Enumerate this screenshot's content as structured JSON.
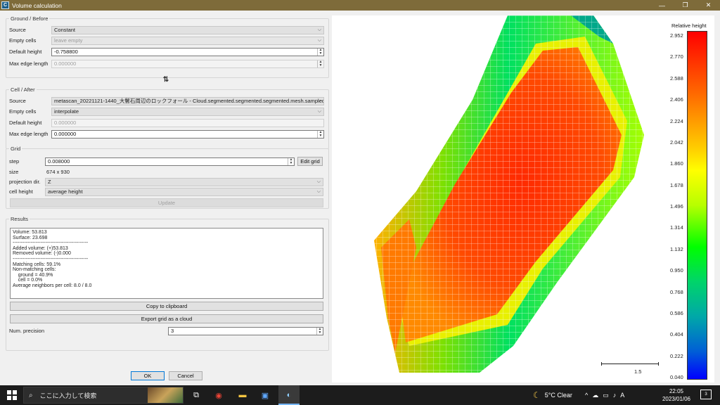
{
  "window": {
    "title": "Volume calculation",
    "icon_text": "C",
    "minimize": "—",
    "maximize": "❐",
    "close": "✕"
  },
  "ground": {
    "group_title": "Ground / Before",
    "source_label": "Source",
    "source_value": "Constant",
    "empty_label": "Empty cells",
    "empty_value": "leave empty",
    "default_height_label": "Default height",
    "default_height_value": "-0.758800",
    "max_edge_label": "Max edge length",
    "max_edge_value": "0.000000"
  },
  "swap_icon": "⇅",
  "cell": {
    "group_title": "Cell / After",
    "source_label": "Source",
    "source_value": "metascan_20221121-1440_大鬢石周辺のロックフォール - Cloud.segmented.segmented.segmented.mesh.sampled",
    "empty_label": "Empty cells",
    "empty_value": "interpolate",
    "default_height_label": "Default height",
    "default_height_value": "0.000000",
    "max_edge_label": "Max edge length",
    "max_edge_value": "0.000000"
  },
  "grid": {
    "group_title": "Grid",
    "step_label": "step",
    "step_value": "0.008000",
    "edit_grid": "Edit grid",
    "size_label": "size",
    "size_value": "674 x 930",
    "projection_label": "projection dir.",
    "projection_value": "Z",
    "cell_height_label": "cell height",
    "cell_height_value": "average height",
    "update": "Update"
  },
  "results": {
    "group_title": "Results",
    "text": "Volume: 53.813\nSurface: 23.698\n----------------------------------------------\nAdded volume: (+)53.813\nRemoved volume: (-)0.000\n----------------------------------------------\nMatching cells: 59.1%\nNon-matching cells:\n    ground = 40.9%\n    cell = 0.0%\nAverage neighbors per cell: 8.0 / 8.0",
    "copy": "Copy to clipboard",
    "export": "Export grid as a cloud",
    "precision_label": "Num. precision",
    "precision_value": "3"
  },
  "dialog": {
    "ok": "OK",
    "cancel": "Cancel"
  },
  "scale": {
    "title": "Relative height",
    "ticks": [
      "2.952",
      "2.770",
      "2.588",
      "2.406",
      "2.224",
      "2.042",
      "1.860",
      "1.678",
      "1.496",
      "1.314",
      "1.132",
      "0.950",
      "0.768",
      "0.586",
      "0.404",
      "0.222",
      "0.040"
    ],
    "ruler_label": "1.5",
    "colors": {
      "high": "#ff0000",
      "mid": "#ffff00",
      "low_mid": "#00ff00",
      "low": "#0000ff"
    }
  },
  "taskbar": {
    "search_placeholder": "ここに入力して検索",
    "weather": "5°C Clear",
    "ime": "A",
    "time": "22:05",
    "date": "2023/01/06",
    "notif_count": "3"
  }
}
